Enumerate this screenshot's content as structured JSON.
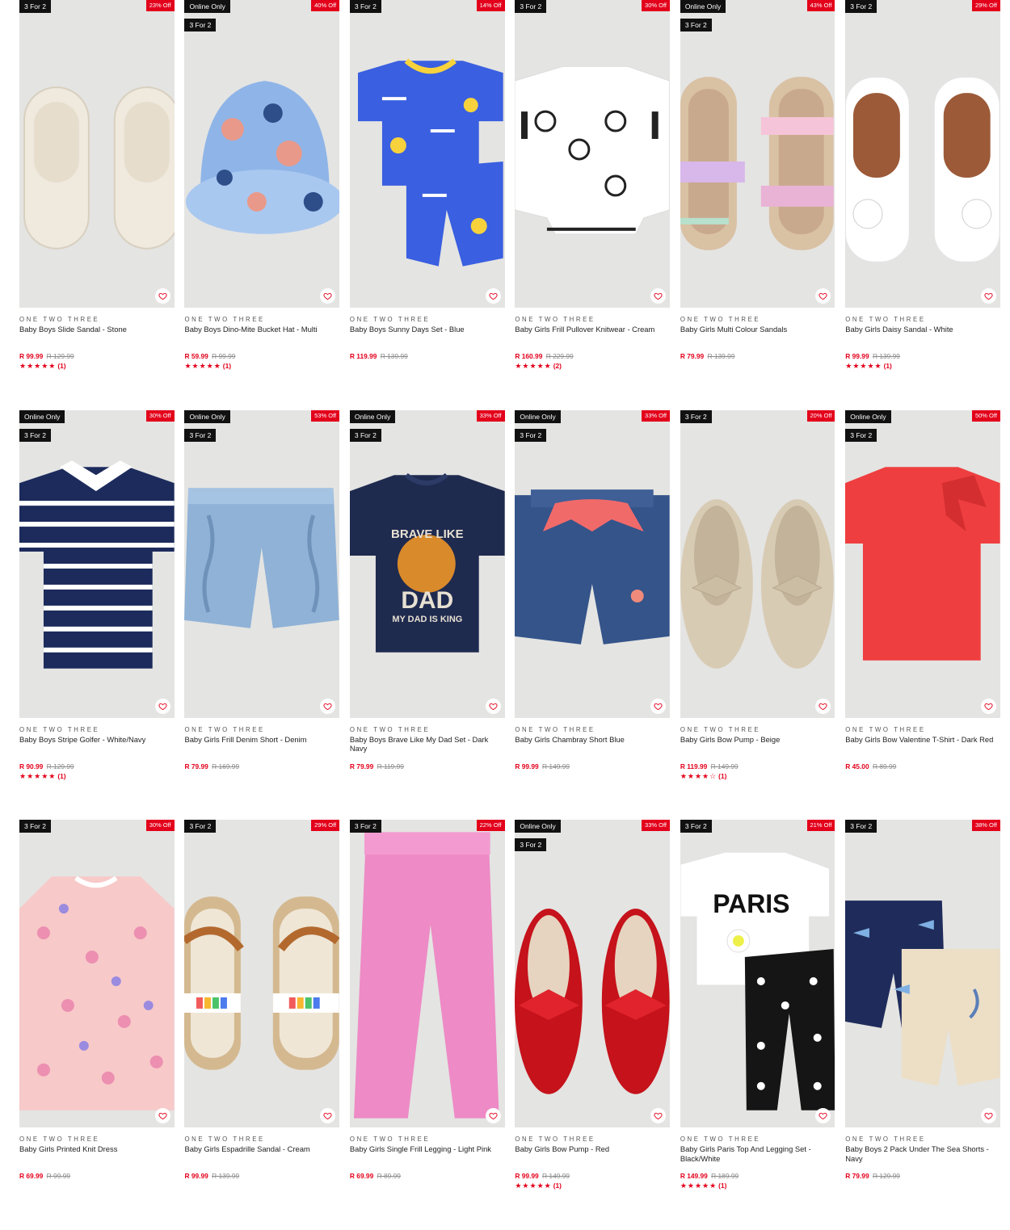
{
  "colors": {
    "accent": "#e3001b",
    "badge": "#111111",
    "image_bg": "#e4e4e2"
  },
  "products": [
    {
      "badges": [
        "3 For 2"
      ],
      "discount": "23% Off",
      "brand": "ONE TWO THREE",
      "name": "Baby Boys Slide Sandal - Stone",
      "price": "R 99.99",
      "was": "R 129.99",
      "stars": "★★★★★",
      "rating_count": "(1)",
      "art": "slides"
    },
    {
      "badges": [
        "Online Only",
        "3 For 2"
      ],
      "discount": "40% Off",
      "brand": "ONE TWO THREE",
      "name": "Baby Boys Dino-Mite Bucket Hat - Multi",
      "price": "R 59.99",
      "was": "R 99.99",
      "stars": "★★★★★",
      "rating_count": "(1)",
      "art": "hat"
    },
    {
      "badges": [
        "3 For 2"
      ],
      "discount": "14% Off",
      "brand": "ONE TWO THREE",
      "name": "Baby Boys Sunny Days Set - Blue",
      "price": "R 119.99",
      "was": "R 139.99",
      "stars": "",
      "rating_count": "",
      "art": "blueset"
    },
    {
      "badges": [
        "3 For 2"
      ],
      "discount": "30% Off",
      "brand": "ONE TWO THREE",
      "name": "Baby Girls Frill Pullover Knitwear - Cream",
      "price": "R 160.99",
      "was": "R 229.99",
      "stars": "★★★★★",
      "rating_count": "(2)",
      "art": "knit"
    },
    {
      "badges": [
        "Online Only",
        "3 For 2"
      ],
      "discount": "43% Off",
      "brand": "ONE TWO THREE",
      "name": "Baby Girls Multi Colour Sandals",
      "price": "R 79.99",
      "was": "R 139.99",
      "stars": "",
      "rating_count": "",
      "art": "rainbowsandal"
    },
    {
      "badges": [
        "3 For 2"
      ],
      "discount": "29% Off",
      "brand": "ONE TWO THREE",
      "name": "Baby Girls Daisy Sandal - White",
      "price": "R 99.99",
      "was": "R 139.99",
      "stars": "★★★★★",
      "rating_count": "(1)",
      "art": "whitesandal"
    },
    {
      "badges": [
        "Online Only",
        "3 For 2"
      ],
      "discount": "30% Off",
      "brand": "ONE TWO THREE",
      "name": "Baby Boys Stripe Golfer - White/Navy",
      "price": "R 90.99",
      "was": "R 129.99",
      "stars": "★★★★★",
      "rating_count": "(1)",
      "art": "golfer"
    },
    {
      "badges": [
        "Online Only",
        "3 For 2"
      ],
      "discount": "53% Off",
      "brand": "ONE TWO THREE",
      "name": "Baby Girls Frill Denim Short - Denim",
      "price": "R 79.99",
      "was": "R 169.99",
      "stars": "",
      "rating_count": "",
      "art": "denimshort"
    },
    {
      "badges": [
        "Online Only",
        "3 For 2"
      ],
      "discount": "33% Off",
      "brand": "ONE TWO THREE",
      "name": "Baby Boys Brave Like My Dad Set - Dark Navy",
      "price": "R 79.99",
      "was": "R 119.99",
      "stars": "",
      "rating_count": "",
      "art": "navytee"
    },
    {
      "badges": [
        "Online Only",
        "3 For 2"
      ],
      "discount": "33% Off",
      "brand": "ONE TWO THREE",
      "name": "Baby Girls Chambray Short Blue",
      "price": "R 99.99",
      "was": "R 149.99",
      "stars": "",
      "rating_count": "",
      "art": "chambray"
    },
    {
      "badges": [
        "3 For 2"
      ],
      "discount": "20% Off",
      "brand": "ONE TWO THREE",
      "name": "Baby Girls Bow Pump - Beige",
      "price": "R 119.99",
      "was": "R 149.99",
      "stars": "★★★★☆",
      "rating_count": "(1)",
      "art": "beigepump"
    },
    {
      "badges": [
        "Online Only",
        "3 For 2"
      ],
      "discount": "50% Off",
      "brand": "ONE TWO THREE",
      "name": "Baby Girls Bow Valentine T-Shirt - Dark Red",
      "price": "R 45.00",
      "was": "R 89.99",
      "stars": "",
      "rating_count": "",
      "art": "redtee"
    },
    {
      "badges": [
        "3 For 2"
      ],
      "discount": "30% Off",
      "brand": "ONE TWO THREE",
      "name": "Baby Girls Printed Knit Dress",
      "price": "R 69.99",
      "was": "R 99.99",
      "stars": "",
      "rating_count": "",
      "art": "dress"
    },
    {
      "badges": [
        "3 For 2"
      ],
      "discount": "29% Off",
      "brand": "ONE TWO THREE",
      "name": "Baby Girls Espadrille Sandal - Cream",
      "price": "R 99.99",
      "was": "R 139.99",
      "stars": "",
      "rating_count": "",
      "art": "espadrille"
    },
    {
      "badges": [
        "3 For 2"
      ],
      "discount": "22% Off",
      "brand": "ONE TWO THREE",
      "name": "Baby Girls Single Frill Legging - Light Pink",
      "price": "R 69.99",
      "was": "R 89.99",
      "stars": "",
      "rating_count": "",
      "art": "legging"
    },
    {
      "badges": [
        "Online Only",
        "3 For 2"
      ],
      "discount": "33% Off",
      "brand": "ONE TWO THREE",
      "name": "Baby Girls Bow Pump - Red",
      "price": "R 99.99",
      "was": "R 149.99",
      "stars": "★★★★★",
      "rating_count": "(1)",
      "art": "redpump"
    },
    {
      "badges": [
        "3 For 2"
      ],
      "discount": "21% Off",
      "brand": "ONE TWO THREE",
      "name": "Baby Girls Paris Top And Legging Set - Black/White",
      "price": "R 149.99",
      "was": "R 189.99",
      "stars": "★★★★★",
      "rating_count": "(1)",
      "art": "paris",
      "art_text": "PARIS"
    },
    {
      "badges": [
        "3 For 2"
      ],
      "discount": "38% Off",
      "brand": "ONE TWO THREE",
      "name": "Baby Boys 2 Pack Under The Sea Shorts - Navy",
      "price": "R 79.99",
      "was": "R 129.99",
      "stars": "",
      "rating_count": "",
      "art": "seashorts"
    }
  ],
  "art_text": {
    "navytee_line1": "BRAVE LIKE",
    "navytee_line2": "DAD",
    "navytee_line3": "MY DAD IS KING"
  }
}
